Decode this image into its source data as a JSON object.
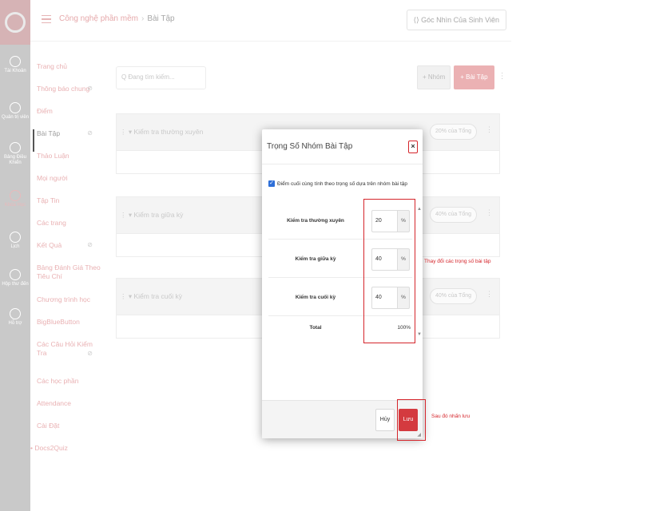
{
  "header": {
    "course": "Công nghệ phần mềm",
    "separator": "›",
    "page": "Bài Tập",
    "student_view": "Góc Nhìn Của Sinh Viên"
  },
  "global_nav": [
    {
      "label": "Tài Khoản"
    },
    {
      "label": "Quản trị viên"
    },
    {
      "label": "Bảng Điều Khiển"
    },
    {
      "label": "Khóa Học"
    },
    {
      "label": "Lịch"
    },
    {
      "label": "Hộp thư đến"
    },
    {
      "label": "Hỗ trợ"
    }
  ],
  "course_nav": [
    "Trang chủ",
    "Thông báo chung",
    "Điểm",
    "Bài Tập",
    "Thảo Luận",
    "Mọi người",
    "Tập Tin",
    "Các trang",
    "Kết Quả",
    "Bảng Đánh Giá Theo Tiêu Chí",
    "Chương trình học",
    "BigBlueButton",
    "Các Câu Hỏi Kiểm Tra",
    "Các học phần",
    "Attendance",
    "Cài Đặt",
    "Docs2Quiz"
  ],
  "toolbar": {
    "search_placeholder": "Q  Đang tìm kiếm...",
    "add_group": "+ Nhóm",
    "add_assignment": "+ Bài Tập",
    "more": "⋮"
  },
  "groups": [
    {
      "title": "Kiểm tra thường xuyên",
      "pct": "20% của Tổng"
    },
    {
      "title": "Kiểm tra giữa kỳ",
      "pct": "40% của Tổng"
    },
    {
      "title": "Kiểm tra cuối kỳ",
      "pct": "40% của Tổng"
    }
  ],
  "modal": {
    "title": "Trọng Số Nhóm Bài Tập",
    "close": "×",
    "checkbox_label": "Điểm cuối cùng tính theo trọng số dựa trên nhóm bài tập",
    "rows": [
      {
        "label": "Kiểm tra thường xuyên",
        "value": "20",
        "unit": "%"
      },
      {
        "label": "Kiểm tra giữa kỳ",
        "value": "40",
        "unit": "%"
      },
      {
        "label": "Kiểm tra cuối kỳ",
        "value": "40",
        "unit": "%"
      }
    ],
    "total_label": "Total",
    "total_value": "100%",
    "cancel": "Hủy",
    "save": "Lưu"
  },
  "annotations": {
    "change_weights": "Thay đổi các trọng số bài tập",
    "then_save": "Sau đó nhấn lưu"
  },
  "colors": {
    "accent": "#d43a3f",
    "annotation": "#d5252b"
  }
}
